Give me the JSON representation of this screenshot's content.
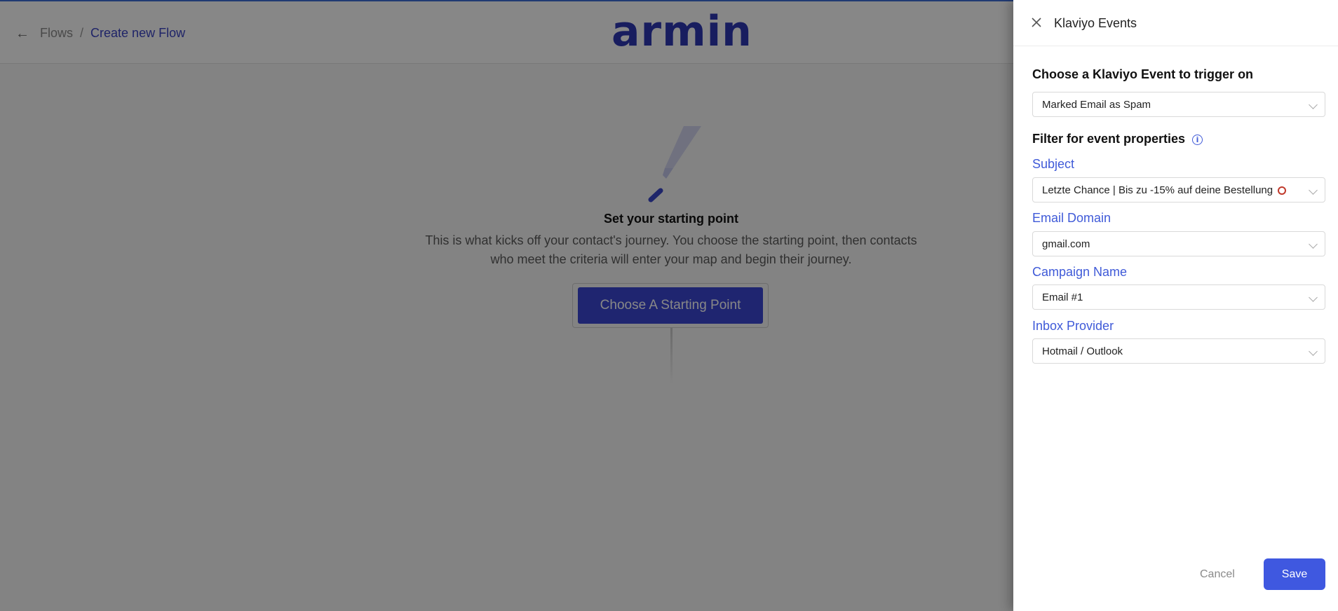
{
  "header": {
    "breadcrumb_root": "Flows",
    "breadcrumb_sep": "/",
    "breadcrumb_current": "Create new Flow",
    "logo_text": "armin"
  },
  "canvas": {
    "title": "Set your starting point",
    "description": "This is what kicks off your contact's journey. You choose the starting point, then contacts who meet the criteria will enter your map and begin their journey.",
    "button_label": "Choose A Starting Point"
  },
  "drawer": {
    "title": "Klaviyo Events",
    "event_heading": "Choose a Klaviyo Event to trigger on",
    "event_value": "Marked Email as Spam",
    "filter_heading": "Filter for event properties",
    "fields": [
      {
        "label": "Subject",
        "value": "Letzte Chance | Bis zu -15% auf deine Bestellung"
      },
      {
        "label": "Email Domain",
        "value": "gmail.com"
      },
      {
        "label": "Campaign Name",
        "value": "Email #1"
      },
      {
        "label": "Inbox Provider",
        "value": "Hotmail / Outlook"
      }
    ],
    "cancel_label": "Cancel",
    "save_label": "Save"
  },
  "icons": {
    "back": "arrow-left-icon",
    "close": "close-icon",
    "info": "info-icon",
    "chevron": "chevron-down-icon",
    "bolt": "lightning-bolt-icon",
    "alarm": "alarm-clock-emoji-icon"
  },
  "colors": {
    "brand": "#2e37b3",
    "primary_button": "#3b46d3",
    "save_button": "#3f58e0",
    "label_blue": "#3f5ad8"
  }
}
